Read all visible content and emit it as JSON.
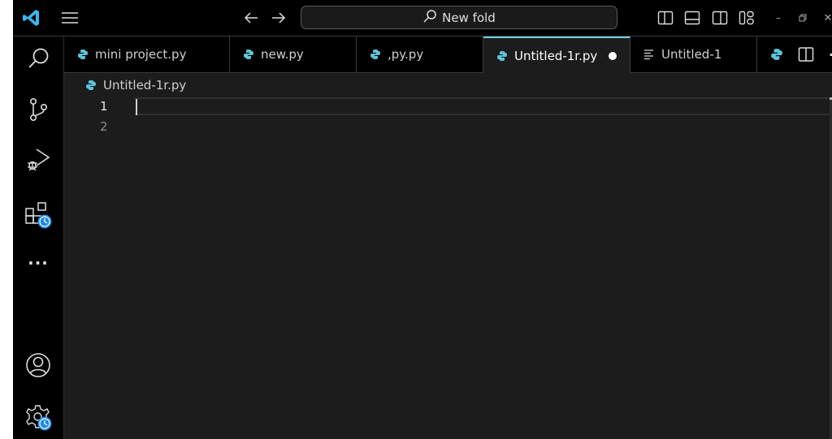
{
  "titlebar": {
    "search_text": "New fold",
    "icons": {
      "logo": "vscode-logo-icon",
      "menu": "hamburger-menu-icon",
      "back": "arrow-left-icon",
      "forward": "arrow-right-icon",
      "search": "search-icon",
      "layout": [
        "toggle-primary-sidebar-icon",
        "toggle-panel-icon",
        "toggle-secondary-sidebar-icon",
        "customize-layout-icon"
      ],
      "window": [
        "minimize-icon",
        "restore-icon",
        "close-icon"
      ]
    },
    "minimize_glyph": "–",
    "close_glyph": "✕"
  },
  "activity_bar": {
    "items": [
      {
        "name": "search",
        "icon": "search-icon"
      },
      {
        "name": "source-control",
        "icon": "source-control-icon"
      },
      {
        "name": "run-debug",
        "icon": "run-debug-icon"
      },
      {
        "name": "extensions",
        "icon": "extensions-icon",
        "badge": "clock-badge"
      },
      {
        "name": "more",
        "icon": "more-icon",
        "label": "···"
      }
    ],
    "bottom": [
      {
        "name": "accounts",
        "icon": "account-icon"
      },
      {
        "name": "manage",
        "icon": "gear-icon",
        "badge": "clock-badge"
      }
    ]
  },
  "tabs": [
    {
      "label": "mini project.py",
      "icon": "python-icon",
      "active": false
    },
    {
      "label": "new.py",
      "icon": "python-icon",
      "active": false
    },
    {
      "label": ",py.py",
      "icon": "python-icon",
      "active": false
    },
    {
      "label": "Untitled-1r.py",
      "icon": "python-icon",
      "active": true,
      "dirty": true
    },
    {
      "label": "Untitled-1",
      "icon": "text-file-icon",
      "active": false
    }
  ],
  "tab_actions": {
    "run_icon": "python-icon",
    "split_icon": "split-editor-icon",
    "more_label": "···"
  },
  "editor": {
    "breadcrumb": "Untitled-1r.py",
    "lines": [
      "1",
      "2"
    ],
    "current_line": 1
  },
  "colors": {
    "accent": "#6ad3e0",
    "python_icon": "#5ec4d8",
    "badge_blue": "#1e8ae6",
    "editor_bg": "#1c1c1c"
  }
}
